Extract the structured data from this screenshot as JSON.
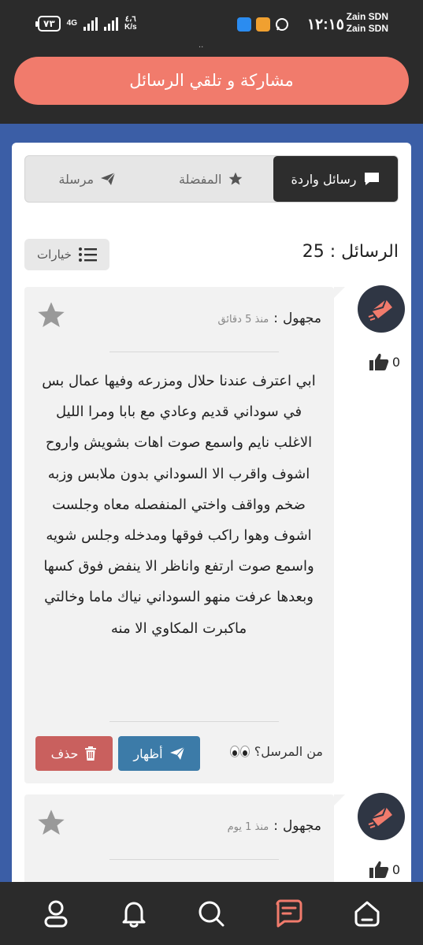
{
  "status_bar": {
    "carrier_line1": "Zain SDN",
    "carrier_line2": "Zain SDN",
    "time": "١٢:١٥",
    "battery": "٧٣",
    "network": "4G",
    "speed_value": "٤،٦",
    "speed_unit": "K/s",
    "dots": ".."
  },
  "header": {
    "title": "مشاركة و تلقي الرسائل"
  },
  "tabs": [
    {
      "label": "رسائل واردة",
      "icon": "chat-bubble-icon",
      "active": true
    },
    {
      "label": "المفضلة",
      "icon": "star-icon",
      "active": false
    },
    {
      "label": "مرسلة",
      "icon": "paper-plane-icon",
      "active": false
    }
  ],
  "messages_count": {
    "text": "الرسائل : 25"
  },
  "options_button": {
    "label": "خيارات",
    "icon": "list-icon"
  },
  "messages": [
    {
      "sender": "مجهول",
      "separator": ":",
      "time": "منذ 5 دقائق",
      "likes": "0",
      "body": "ابي اعترف عندنا حلال ومزرعه وفيها عمال بس في سوداني قديم وعادي مع بابا ومرا الليل الاغلب نايم واسمع صوت اهات بشويش واروح اشوف واقرب الا السوداني بدون ملابس وزبه ضخم وواقف واختي المنفصله معاه وجلست اشوف وهوا راكب فوقها ومدخله وجلس شويه واسمع صوت ارتفع واناظر الا ينفض فوق كسها وبعدها عرفت منهو السوداني نياك ماما وخالتي ماكبرت المكاوي الا منه",
      "who_sent_label": "من المرسل؟",
      "reveal_label": "أظهار",
      "delete_label": "حذف"
    },
    {
      "sender": "مجهول",
      "separator": ":",
      "time": "منذ 1 يوم",
      "likes": "0"
    }
  ],
  "bottom_nav": [
    "home-icon",
    "messages-icon",
    "search-icon",
    "bell-icon",
    "user-icon"
  ],
  "colors": {
    "dark": "#2b2b2b",
    "accent": "#f17b6c",
    "page_bg": "#3b5ea6",
    "reveal": "#3c7ba8",
    "delete": "#c9605e",
    "nav_active": "#f17b6c"
  }
}
